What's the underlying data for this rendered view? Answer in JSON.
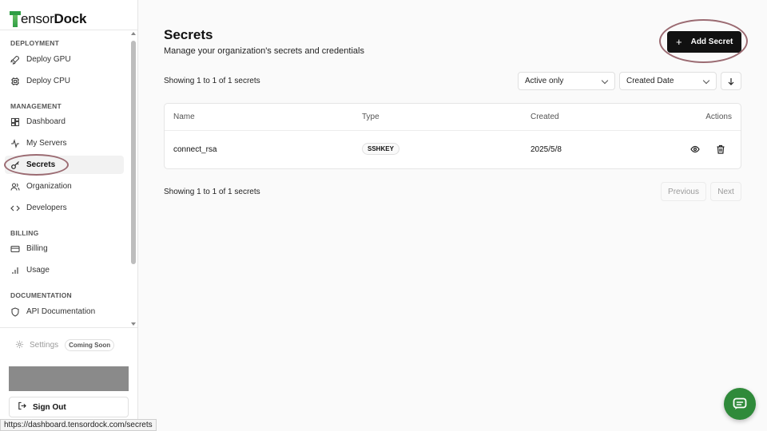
{
  "brand": {
    "prefix": "ensor",
    "suffix": "Dock"
  },
  "sidebar": {
    "sections": {
      "deployment": "DEPLOYMENT",
      "management": "MANAGEMENT",
      "billing": "BILLING",
      "documentation": "DOCUMENTATION"
    },
    "items": {
      "deploy_gpu": "Deploy GPU",
      "deploy_cpu": "Deploy CPU",
      "dashboard": "Dashboard",
      "my_servers": "My Servers",
      "secrets": "Secrets",
      "organization": "Organization",
      "developers": "Developers",
      "billing": "Billing",
      "usage": "Usage",
      "api_docs": "API Documentation"
    },
    "active_item": "Secrets",
    "settings": {
      "label": "Settings",
      "badge": "Coming Soon"
    },
    "sign_out": "Sign Out"
  },
  "status_url": "https://dashboard.tensordock.com/secrets",
  "main": {
    "title": "Secrets",
    "subtitle": "Manage your organization's secrets and credentials",
    "add_button": "Add Secret",
    "showing_top": "Showing 1 to 1 of 1 secrets",
    "filter_select": "Active only",
    "sort_select": "Created Date",
    "table": {
      "columns": {
        "name": "Name",
        "type": "Type",
        "created": "Created",
        "actions": "Actions"
      },
      "rows": [
        {
          "name": "connect_rsa",
          "type": "SSHKEY",
          "created": "2025/5/8"
        }
      ]
    },
    "showing_bottom": "Showing 1 to 1 of 1 secrets",
    "pagination": {
      "previous": "Previous",
      "next": "Next"
    }
  },
  "colors": {
    "brand_green": "#2f9e44",
    "primary_button": "#111111",
    "highlight_ring": "#9b6b72",
    "chat_fab": "#2f8a3a"
  }
}
